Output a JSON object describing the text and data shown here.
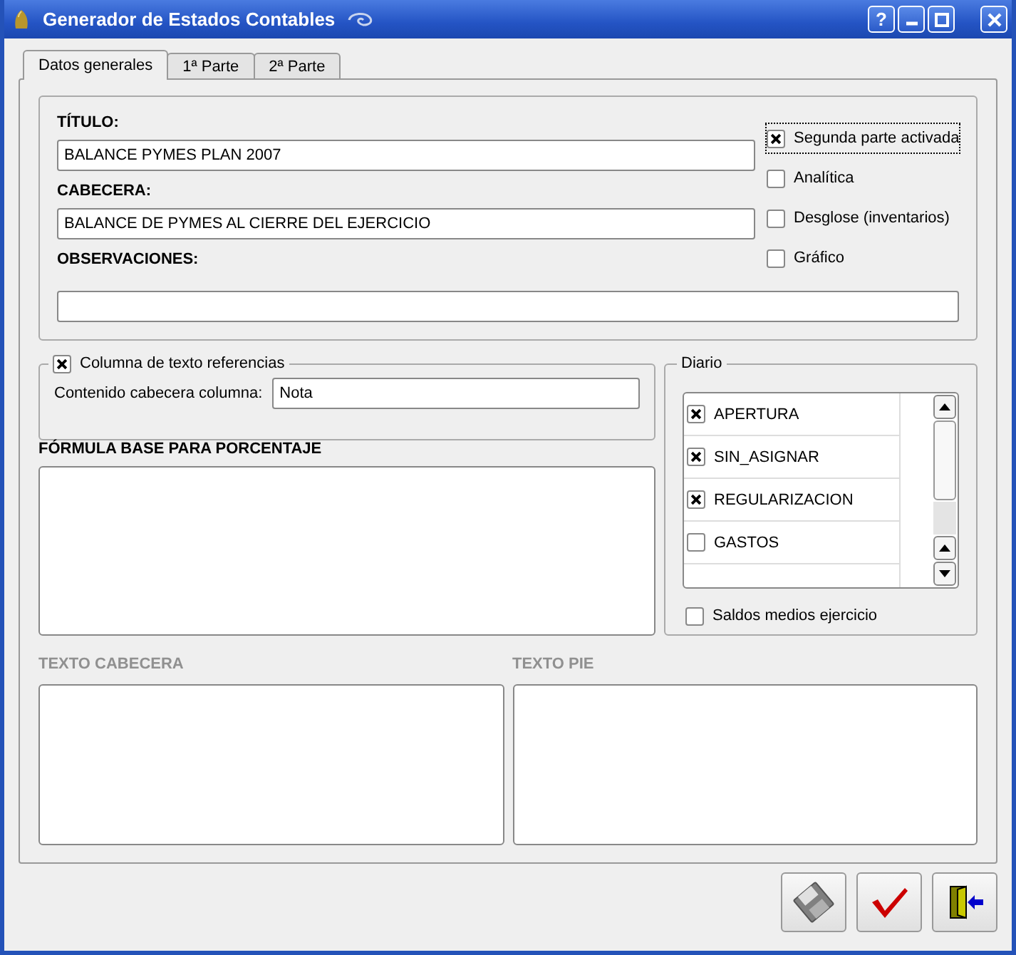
{
  "window": {
    "title": "Generador de Estados Contables"
  },
  "title_buttons": [
    {
      "kind": "help",
      "label": "?"
    },
    {
      "kind": "minimize"
    },
    {
      "kind": "maximize"
    },
    {
      "kind": "close"
    }
  ],
  "tabs": [
    {
      "label": "Datos generales",
      "selected": true
    },
    {
      "label": "1ª Parte",
      "selected": false
    },
    {
      "label": "2ª Parte",
      "selected": false
    }
  ],
  "fields": [
    {
      "label": "TÍTULO:",
      "value": "BALANCE PYMES PLAN 2007"
    },
    {
      "label": "CABECERA:",
      "value": "BALANCE DE PYMES AL CIERRE DEL EJERCICIO"
    },
    {
      "label": "OBSERVACIONES:"
    }
  ],
  "options": [
    {
      "label": "Segunda parte activada",
      "checked": true,
      "focused": true
    },
    {
      "label": "Analítica",
      "checked": false,
      "focused": false
    },
    {
      "label": "Desglose (inventarios)",
      "checked": false,
      "focused": false
    },
    {
      "label": "Gráfico",
      "checked": false,
      "focused": false
    }
  ],
  "reference_column": {
    "label": "Columna de texto referencias",
    "checked": true,
    "field_label": "Contenido cabecera columna:",
    "value": "Nota"
  },
  "formula": {
    "label": "FÓRMULA BASE PARA PORCENTAJE"
  },
  "diario": {
    "title": "Diario",
    "items": [
      {
        "label": "APERTURA",
        "checked": true
      },
      {
        "label": "SIN_ASIGNAR",
        "checked": true
      },
      {
        "label": "REGULARIZACION",
        "checked": true
      },
      {
        "label": "GASTOS",
        "checked": false
      }
    ],
    "average": {
      "label": "Saldos medios ejercicio",
      "checked": false
    }
  },
  "texts": [
    {
      "label": "TEXTO CABECERA",
      "disabled": true
    },
    {
      "label": "TEXTO PIE",
      "disabled": true
    }
  ],
  "buttons": [
    {
      "kind": "save"
    },
    {
      "kind": "accept"
    },
    {
      "kind": "exit"
    }
  ]
}
